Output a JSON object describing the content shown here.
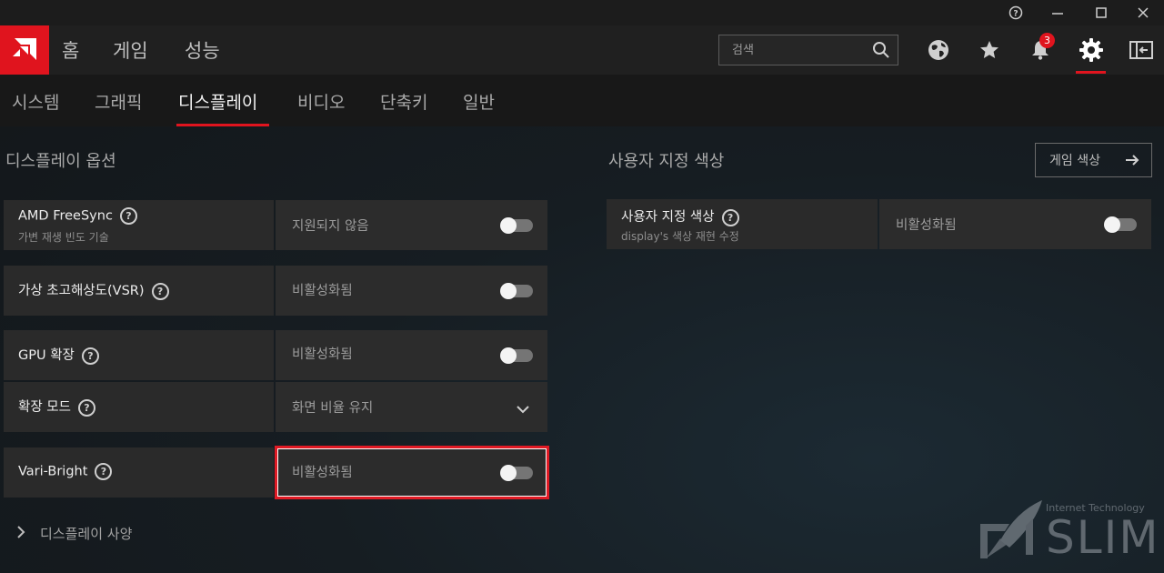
{
  "window_controls": {
    "help": "?",
    "minimize": "—",
    "maximize": "☐",
    "close": "✕"
  },
  "nav": {
    "items": [
      "홈",
      "게임",
      "성능"
    ]
  },
  "search": {
    "placeholder": "검색"
  },
  "notifications": {
    "count": "3"
  },
  "subnav": {
    "items": [
      "시스템",
      "그래픽",
      "디스플레이",
      "비디오",
      "단축키",
      "일반"
    ],
    "active": "디스플레이"
  },
  "display_options": {
    "title": "디스플레이 옵션",
    "rows": [
      {
        "label": "AMD FreeSync",
        "sublabel": "가변 재생 빈도 기술",
        "value": "지원되지 않음",
        "control": "toggle",
        "on": false
      },
      {
        "label": "가상 초고해상도(VSR)",
        "value": "비활성화됨",
        "control": "toggle",
        "on": false
      },
      {
        "label": "GPU 확장",
        "value": "비활성화됨",
        "control": "toggle",
        "on": false
      },
      {
        "label": "확장 모드",
        "value": "화면 비율 유지",
        "control": "dropdown"
      },
      {
        "label": "Vari-Bright",
        "value": "비활성화됨",
        "control": "toggle",
        "on": false
      }
    ],
    "spec_link": "디스플레이 사양"
  },
  "custom_color": {
    "title": "사용자 지정 색상",
    "game_color_button": "게임 색상",
    "row": {
      "label": "사용자 지정 색상",
      "sublabel": "display's 색상 재현 수정",
      "value": "비활성화됨",
      "on": false
    }
  },
  "watermark": {
    "top": "Internet Technology",
    "main": "SLIM"
  },
  "colors": {
    "accent": "#e0141e",
    "panel": "#2a2a2a",
    "header": "#202020"
  }
}
